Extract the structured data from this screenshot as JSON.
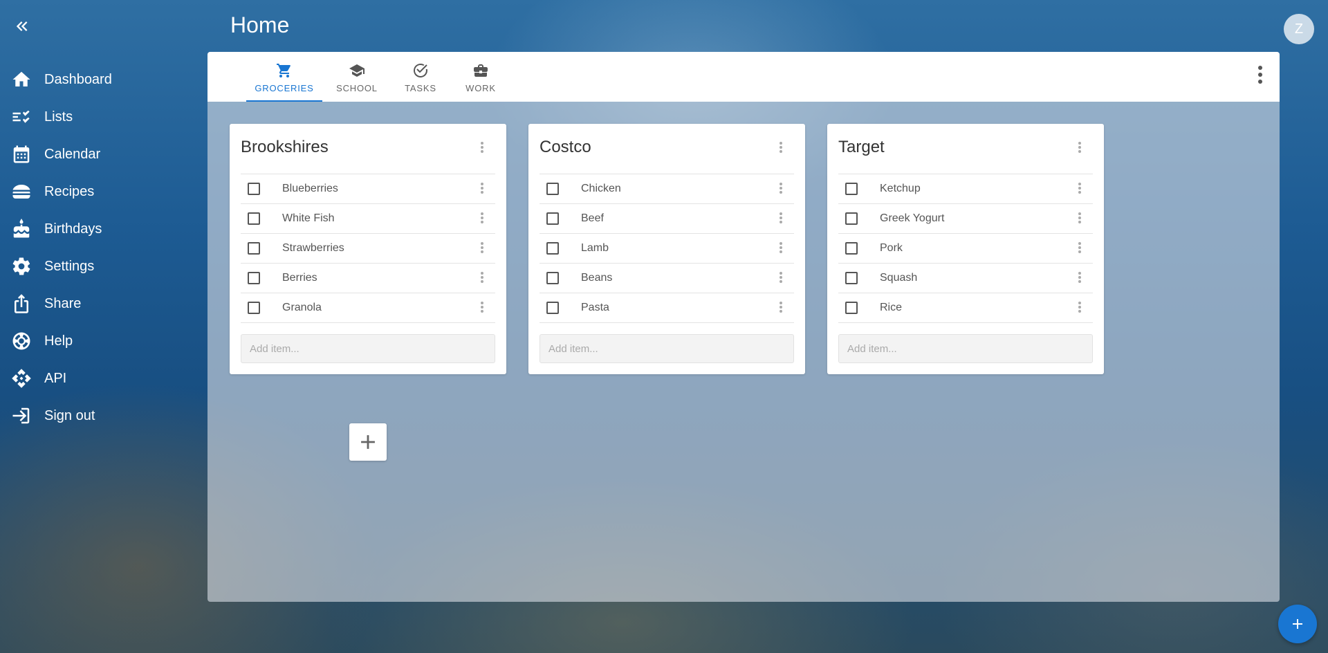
{
  "sidebar": {
    "collapse_icon": "chevron-double-left-icon",
    "items": [
      {
        "label": "Dashboard",
        "icon": "home-icon"
      },
      {
        "label": "Lists",
        "icon": "checklist-icon"
      },
      {
        "label": "Calendar",
        "icon": "calendar-icon"
      },
      {
        "label": "Recipes",
        "icon": "burger-icon"
      },
      {
        "label": "Birthdays",
        "icon": "cake-icon"
      },
      {
        "label": "Settings",
        "icon": "gear-icon"
      },
      {
        "label": "Share",
        "icon": "share-icon"
      },
      {
        "label": "Help",
        "icon": "lifebuoy-icon"
      },
      {
        "label": "API",
        "icon": "api-icon"
      },
      {
        "label": "Sign out",
        "icon": "sign-out-icon"
      }
    ]
  },
  "header": {
    "title": "Home",
    "avatar_initial": "Z"
  },
  "tabs": [
    {
      "label": "GROCERIES",
      "icon": "cart-icon",
      "active": true
    },
    {
      "label": "SCHOOL",
      "icon": "graduation-cap-icon",
      "active": false
    },
    {
      "label": "TASKS",
      "icon": "check-circle-icon",
      "active": false
    },
    {
      "label": "WORK",
      "icon": "briefcase-icon",
      "active": false
    }
  ],
  "lists": [
    {
      "title": "Brookshires",
      "items": [
        "Blueberries",
        "White Fish",
        "Strawberries",
        "Berries",
        "Granola"
      ],
      "add_placeholder": "Add item..."
    },
    {
      "title": "Costco",
      "items": [
        "Chicken",
        "Beef",
        "Lamb",
        "Beans",
        "Pasta"
      ],
      "add_placeholder": "Add item..."
    },
    {
      "title": "Target",
      "items": [
        "Ketchup",
        "Greek Yogurt",
        "Pork",
        "Squash",
        "Rice"
      ],
      "add_placeholder": "Add item..."
    }
  ],
  "colors": {
    "accent": "#1976d2",
    "card": "#ffffff",
    "text": "#333333"
  }
}
